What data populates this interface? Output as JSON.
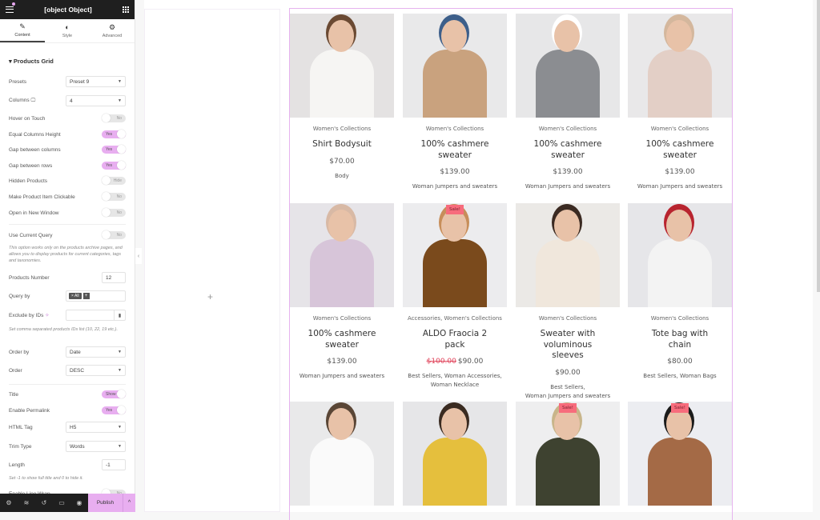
{
  "panel": {
    "title": {
      "label": "Title",
      "value": "Show"
    },
    "tabs": [
      {
        "label": "Content",
        "icon": "pencil-icon"
      },
      {
        "label": "Style",
        "icon": "contrast-icon"
      },
      {
        "label": "Advanced",
        "icon": "gear-icon"
      }
    ],
    "section": "Products Grid",
    "presets": {
      "label": "Presets",
      "value": "Preset 9"
    },
    "columns": {
      "label": "Columns",
      "value": "4"
    },
    "hover_on_touch": {
      "label": "Hover on Touch",
      "value": "No"
    },
    "equal_columns": {
      "label": "Equal Columns Height",
      "value": "Yes"
    },
    "gap_columns": {
      "label": "Gap between columns",
      "value": "Yes"
    },
    "gap_rows": {
      "label": "Gap between rows",
      "value": "Yes"
    },
    "hidden_products": {
      "label": "Hidden Products",
      "value": "Hide"
    },
    "clickable": {
      "label": "Make Product Item Clickable",
      "value": "No"
    },
    "new_window": {
      "label": "Open in New Window",
      "value": "No"
    },
    "current_query": {
      "label": "Use Current Query",
      "value": "No"
    },
    "current_query_note": "This option works only on the products archive pages, and allows you to display products for current categories, tags and taxonomies.",
    "products_number": {
      "label": "Products Number",
      "value": "12"
    },
    "query_by": {
      "label": "Query by",
      "chip": "× All",
      "add": "+"
    },
    "exclude": {
      "label": "Exclude by IDs",
      "value": ""
    },
    "exclude_note": "Set comma separated products IDs list (10, 22, 19 etc.).",
    "order_by": {
      "label": "Order by",
      "value": "Date"
    },
    "order": {
      "label": "Order",
      "value": "DESC"
    },
    "permalink": {
      "label": "Enable Permalink",
      "value": "Yes"
    },
    "html_tag": {
      "label": "HTML Tag",
      "value": "H5"
    },
    "trim_type": {
      "label": "Trim Type",
      "value": "Words"
    },
    "length": {
      "label": "Length",
      "value": "-1"
    },
    "length_note": "Set -1 to show full title and 0 to hide it.",
    "line_wrap": {
      "label": "Enable Line Wrap",
      "value": "No"
    },
    "publish": "Publish"
  },
  "canvas": {
    "add_icon": "+"
  },
  "products": [
    {
      "category": "Women's Collections",
      "name": "Shirt Bodysuit",
      "price": "$70.00",
      "old_price": "",
      "tags": "Body",
      "sale": false
    },
    {
      "category": "Women's Collections",
      "name": "100% cashmere sweater",
      "price": "$139.00",
      "old_price": "",
      "tags": "Woman Jumpers and sweaters",
      "sale": false
    },
    {
      "category": "Women's Collections",
      "name": "100% cashmere sweater",
      "price": "$139.00",
      "old_price": "",
      "tags": "Woman Jumpers and sweaters",
      "sale": false
    },
    {
      "category": "Women's Collections",
      "name": "100% cashmere sweater",
      "price": "$139.00",
      "old_price": "",
      "tags": "Woman Jumpers and sweaters",
      "sale": false
    },
    {
      "category": "Women's Collections",
      "name": "100% cashmere sweater",
      "price": "$139.00",
      "old_price": "",
      "tags": "Woman Jumpers and sweaters",
      "sale": false
    },
    {
      "category": "Accessories, Women's Collections",
      "name": "ALDO Fraocia 2 pack",
      "price": "$90.00",
      "old_price": "$100.00",
      "tags": "Best Sellers, Woman Accessories, Woman Necklace",
      "sale": true
    },
    {
      "category": "Women's Collections",
      "name": "Sweater with voluminous sleeves",
      "price": "$90.00",
      "old_price": "",
      "tags": "Best Sellers, Woman Jumpers and sweaters",
      "sale": false
    },
    {
      "category": "Women's Collections",
      "name": "Tote bag with chain",
      "price": "$80.00",
      "old_price": "",
      "tags": "Best Sellers, Woman Bags",
      "sale": false
    },
    {
      "sale": false
    },
    {
      "sale": false
    },
    {
      "sale": true
    },
    {
      "sale": true
    }
  ],
  "sale_label": "Sale!",
  "colors": {
    "accent": "#e8aef0",
    "sale": "#f76c7c",
    "old_price": "#e0435a"
  }
}
